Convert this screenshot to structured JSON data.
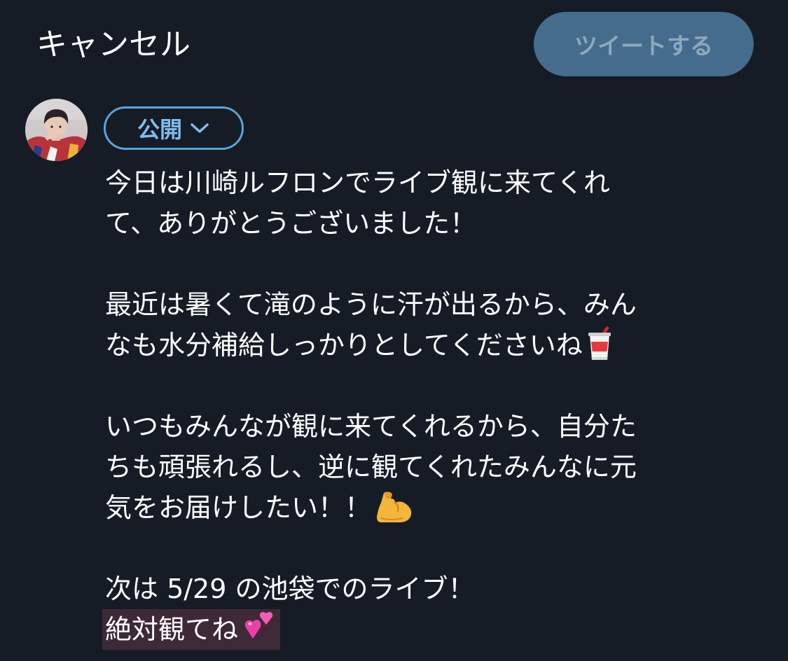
{
  "header": {
    "cancel_label": "キャンセル",
    "tweet_label": "ツイートする"
  },
  "composer": {
    "audience_label": "公開",
    "paragraphs": [
      [
        "今日は川崎ルフロンでライブ観に来てくれ",
        "て、ありがとうございました！"
      ],
      [
        "最近は暑くて滝のように汗が出るから、みん",
        "なも水分補給しっかりとしてくださいね"
      ],
      [
        "いつもみんなが観に来てくれるから、自分た",
        "ちも頑張れるし、逆に観てくれたみんなに元",
        "気をお届けしたい！！"
      ],
      [
        "次は 5/29 の池袋でのライブ！",
        "絶対観てね"
      ]
    ]
  },
  "icons": {
    "drink": "cup-with-straw-icon",
    "muscle": "flexed-biceps-icon",
    "hearts": "two-hearts-icon",
    "audience_chevron": "chevron-down-icon"
  },
  "colors": {
    "background": "#151c26",
    "tweet_button_bg": "#456c8c",
    "tweet_button_text": "#8ea8bd",
    "accent": "#5ba3d9",
    "highlight": "#3e2a36"
  }
}
